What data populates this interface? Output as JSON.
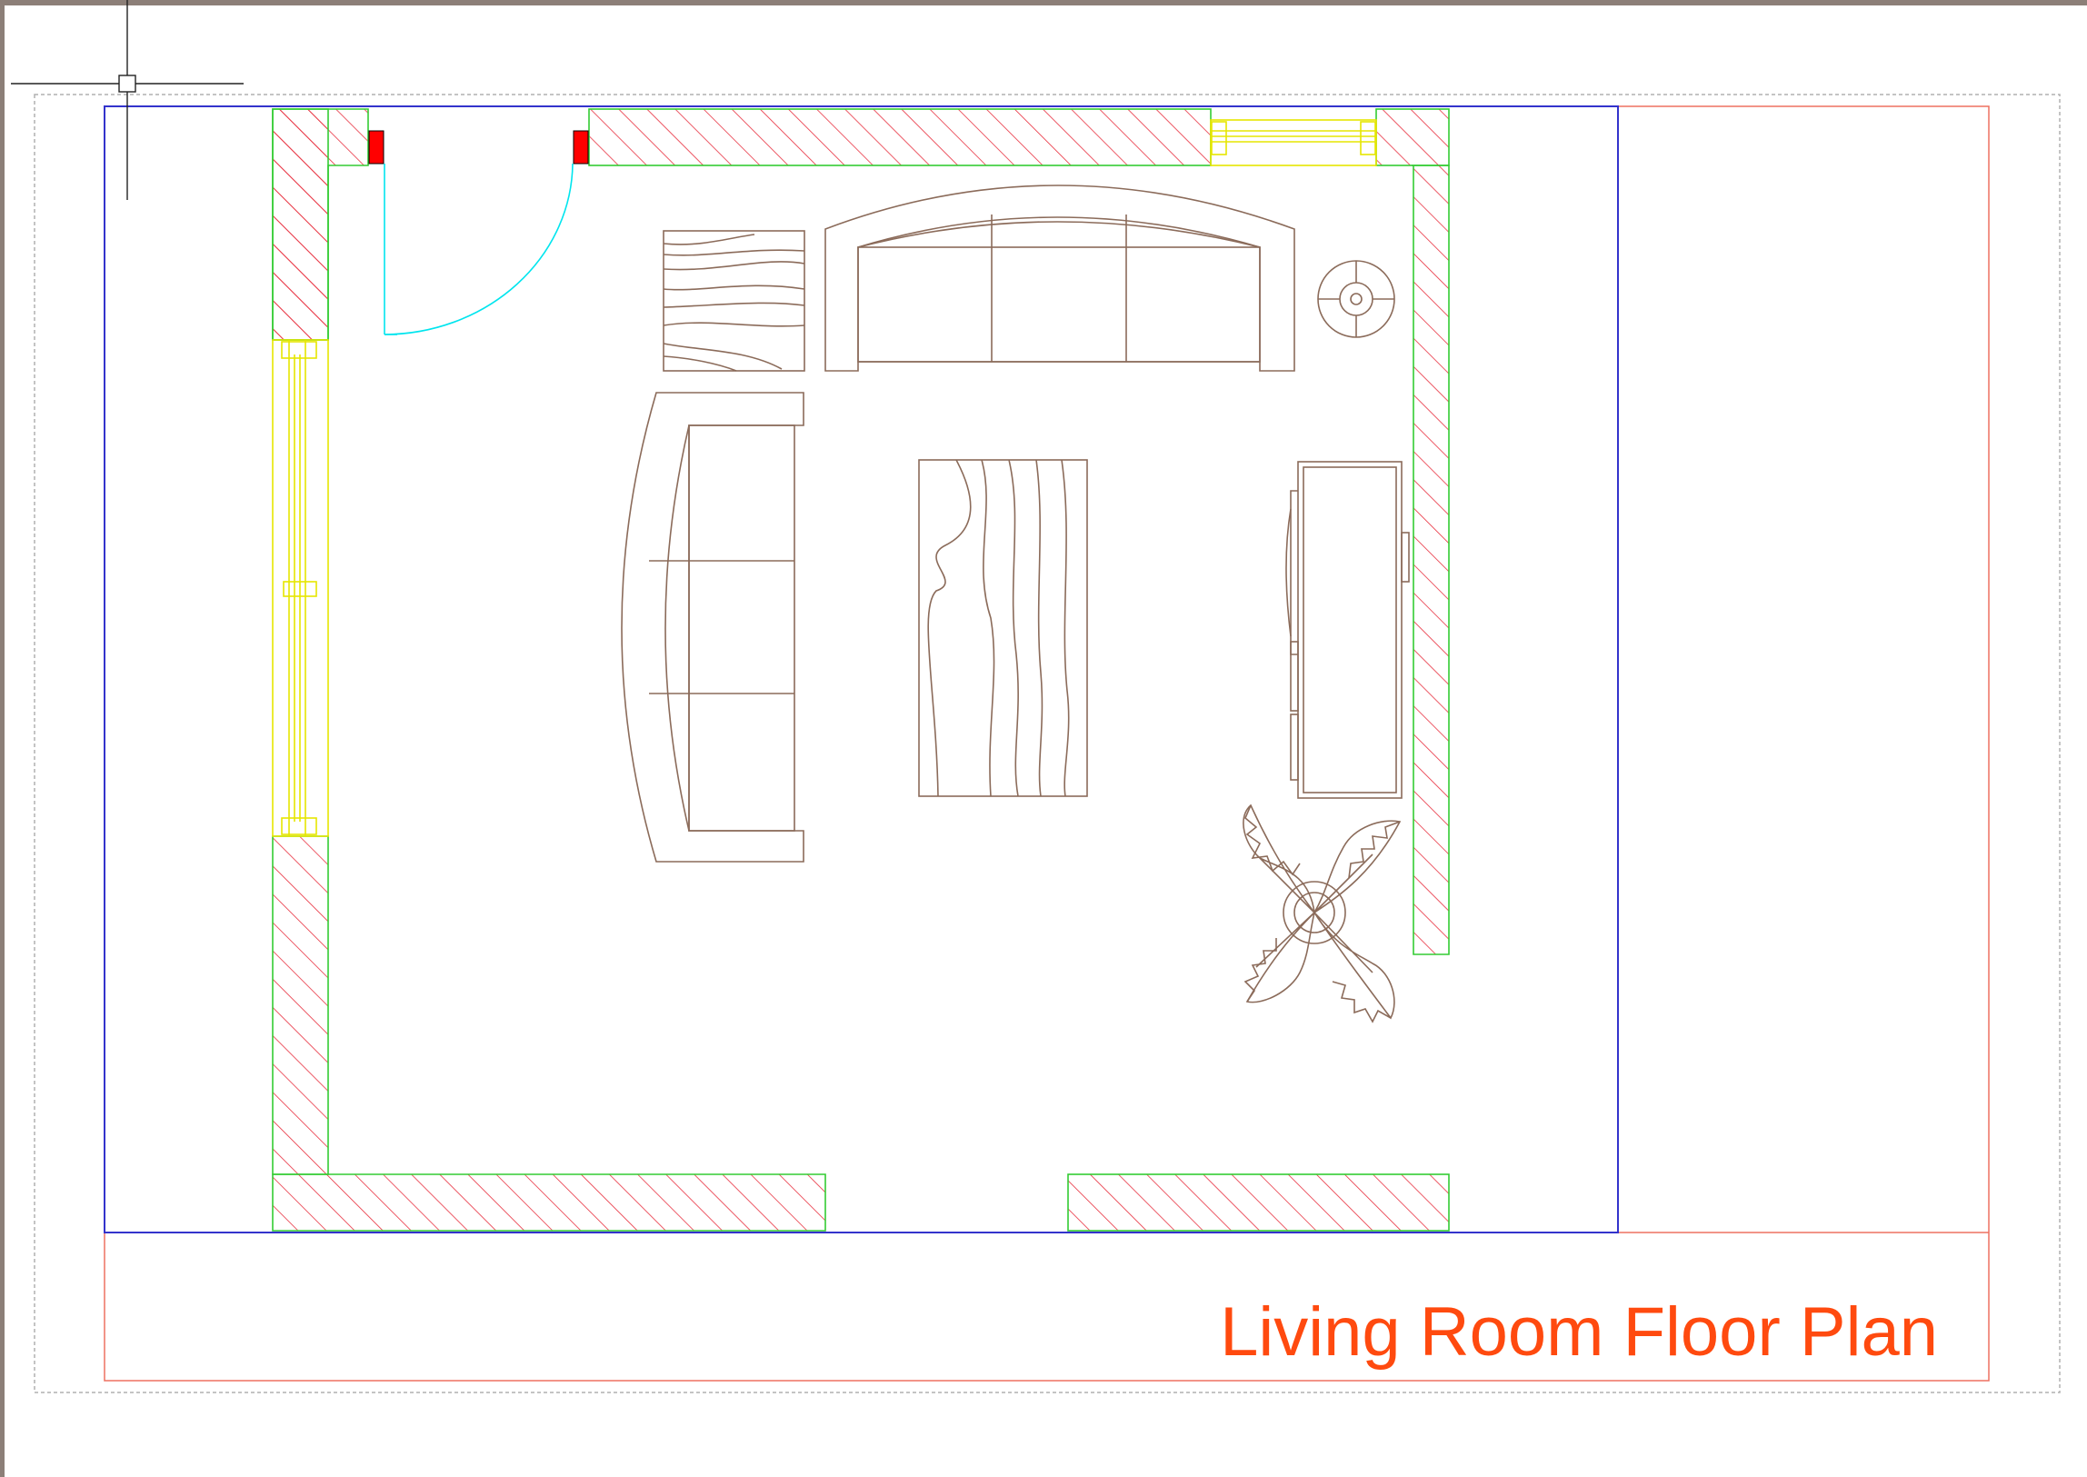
{
  "drawing": {
    "title": "Living Room Floor Plan"
  },
  "colors": {
    "background": "#ffffff",
    "wall_hatch": "#e8303f",
    "wall_outline": "#33cc33",
    "window": "#e6e600",
    "door_swing": "#00e5ee",
    "door_jamb": "#ff0000",
    "furniture": "#8b6b5a",
    "viewport_frame": "#3333cc",
    "sheet_border": "#ee7060",
    "title_text": "#ff4a0f",
    "page_dashed": "#b0b0b0",
    "cursor": "#222222"
  },
  "elements": {
    "walls": [
      "north-wall-left",
      "north-wall-center",
      "north-wall-right",
      "east-wall",
      "west-wall-upper",
      "west-wall-lower",
      "south-wall-left",
      "south-wall-right"
    ],
    "windows": [
      "north-window",
      "west-window"
    ],
    "furniture": [
      "armchair",
      "three-seat-sofa",
      "side-sofa",
      "coffee-table",
      "side-table-lamp",
      "tv-console",
      "potted-plant"
    ]
  }
}
